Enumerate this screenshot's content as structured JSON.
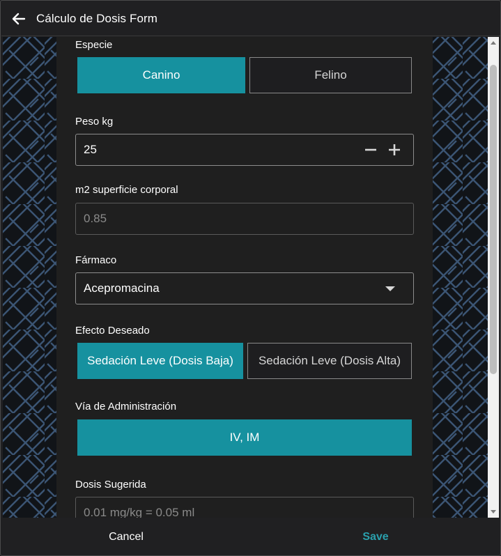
{
  "header": {
    "title": "Cálculo de Dosis Form",
    "back_icon": "arrow-left-icon"
  },
  "form": {
    "especie": {
      "label": "Especie",
      "options": [
        {
          "label": "Canino",
          "selected": true
        },
        {
          "label": "Felino",
          "selected": false
        }
      ]
    },
    "peso": {
      "label": "Peso kg",
      "value": "25",
      "decrement_icon": "minus-icon",
      "increment_icon": "plus-icon"
    },
    "superficie": {
      "label": "m2 superficie corporal",
      "value": "0.85"
    },
    "farmaco": {
      "label": "Fármaco",
      "value": "Acepromacina",
      "dropdown_icon": "caret-down-icon"
    },
    "efecto": {
      "label": "Efecto Deseado",
      "options": [
        {
          "label": "Sedación Leve (Dosis Baja)",
          "selected": true
        },
        {
          "label": "Sedación Leve (Dosis Alta)",
          "selected": false
        }
      ]
    },
    "via": {
      "label": "Vía de Administración",
      "options": [
        {
          "label": "IV, IM",
          "selected": true
        }
      ]
    },
    "dosis": {
      "label": "Dosis Sugerida",
      "value": "0.01 mg/kg = 0.05 ml"
    }
  },
  "footer": {
    "cancel_label": "Cancel",
    "save_label": "Save"
  },
  "colors": {
    "accent": "#16919f",
    "save_text": "#2aa0ad",
    "panel": "#1f1f1f",
    "background": "#111418",
    "pattern": "#3b5574"
  }
}
